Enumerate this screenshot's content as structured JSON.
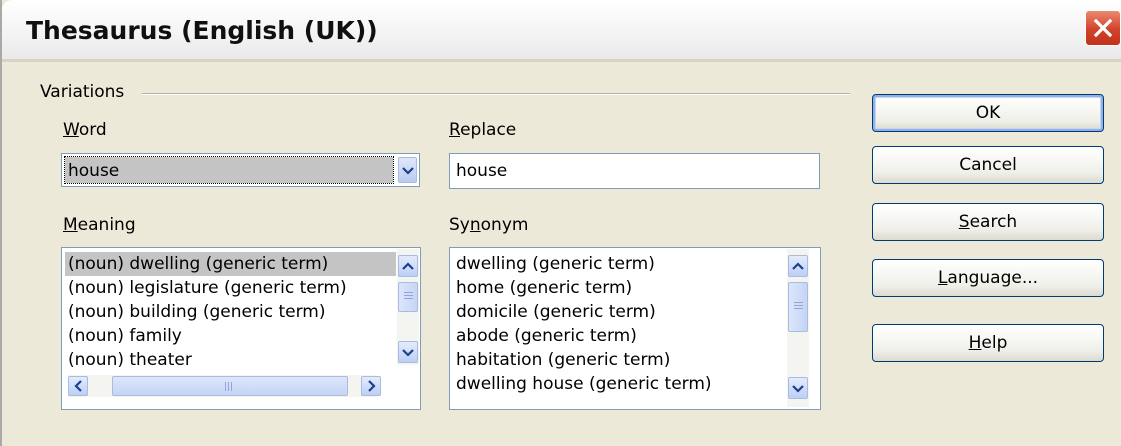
{
  "window": {
    "title": "Thesaurus (English (UK))",
    "close_glyph": "close-icon"
  },
  "group": {
    "label": "Variations"
  },
  "word": {
    "label_mnemonic": "W",
    "label_rest": "ord",
    "value": "house"
  },
  "replace": {
    "label_mnemonic": "R",
    "label_rest": "eplace",
    "value": "house"
  },
  "meaning": {
    "label_mnemonic": "M",
    "label_rest": "eaning",
    "items": [
      "(noun) dwelling (generic term)",
      "(noun) legislature (generic term)",
      "(noun) building (generic term)",
      "(noun) family",
      "(noun) theater"
    ],
    "selected_index": 0
  },
  "synonym": {
    "label_pre": "Sy",
    "label_mnemonic": "n",
    "label_rest": "onym",
    "items": [
      "dwelling (generic term)",
      "home (generic term)",
      "domicile (generic term)",
      "abode (generic term)",
      "habitation (generic term)",
      "dwelling house (generic term)"
    ]
  },
  "buttons": {
    "ok": "OK",
    "cancel": "Cancel",
    "search_mnemonic": "S",
    "search_rest": "earch",
    "language_mnemonic": "L",
    "language_rest": "anguage...",
    "help_mnemonic": "H",
    "help_rest": "elp"
  },
  "colors": {
    "dialog_bg": "#ece9d8",
    "selection_bg": "#c4c4c4",
    "button_border": "#003c74",
    "close_red": "#d2422a"
  }
}
